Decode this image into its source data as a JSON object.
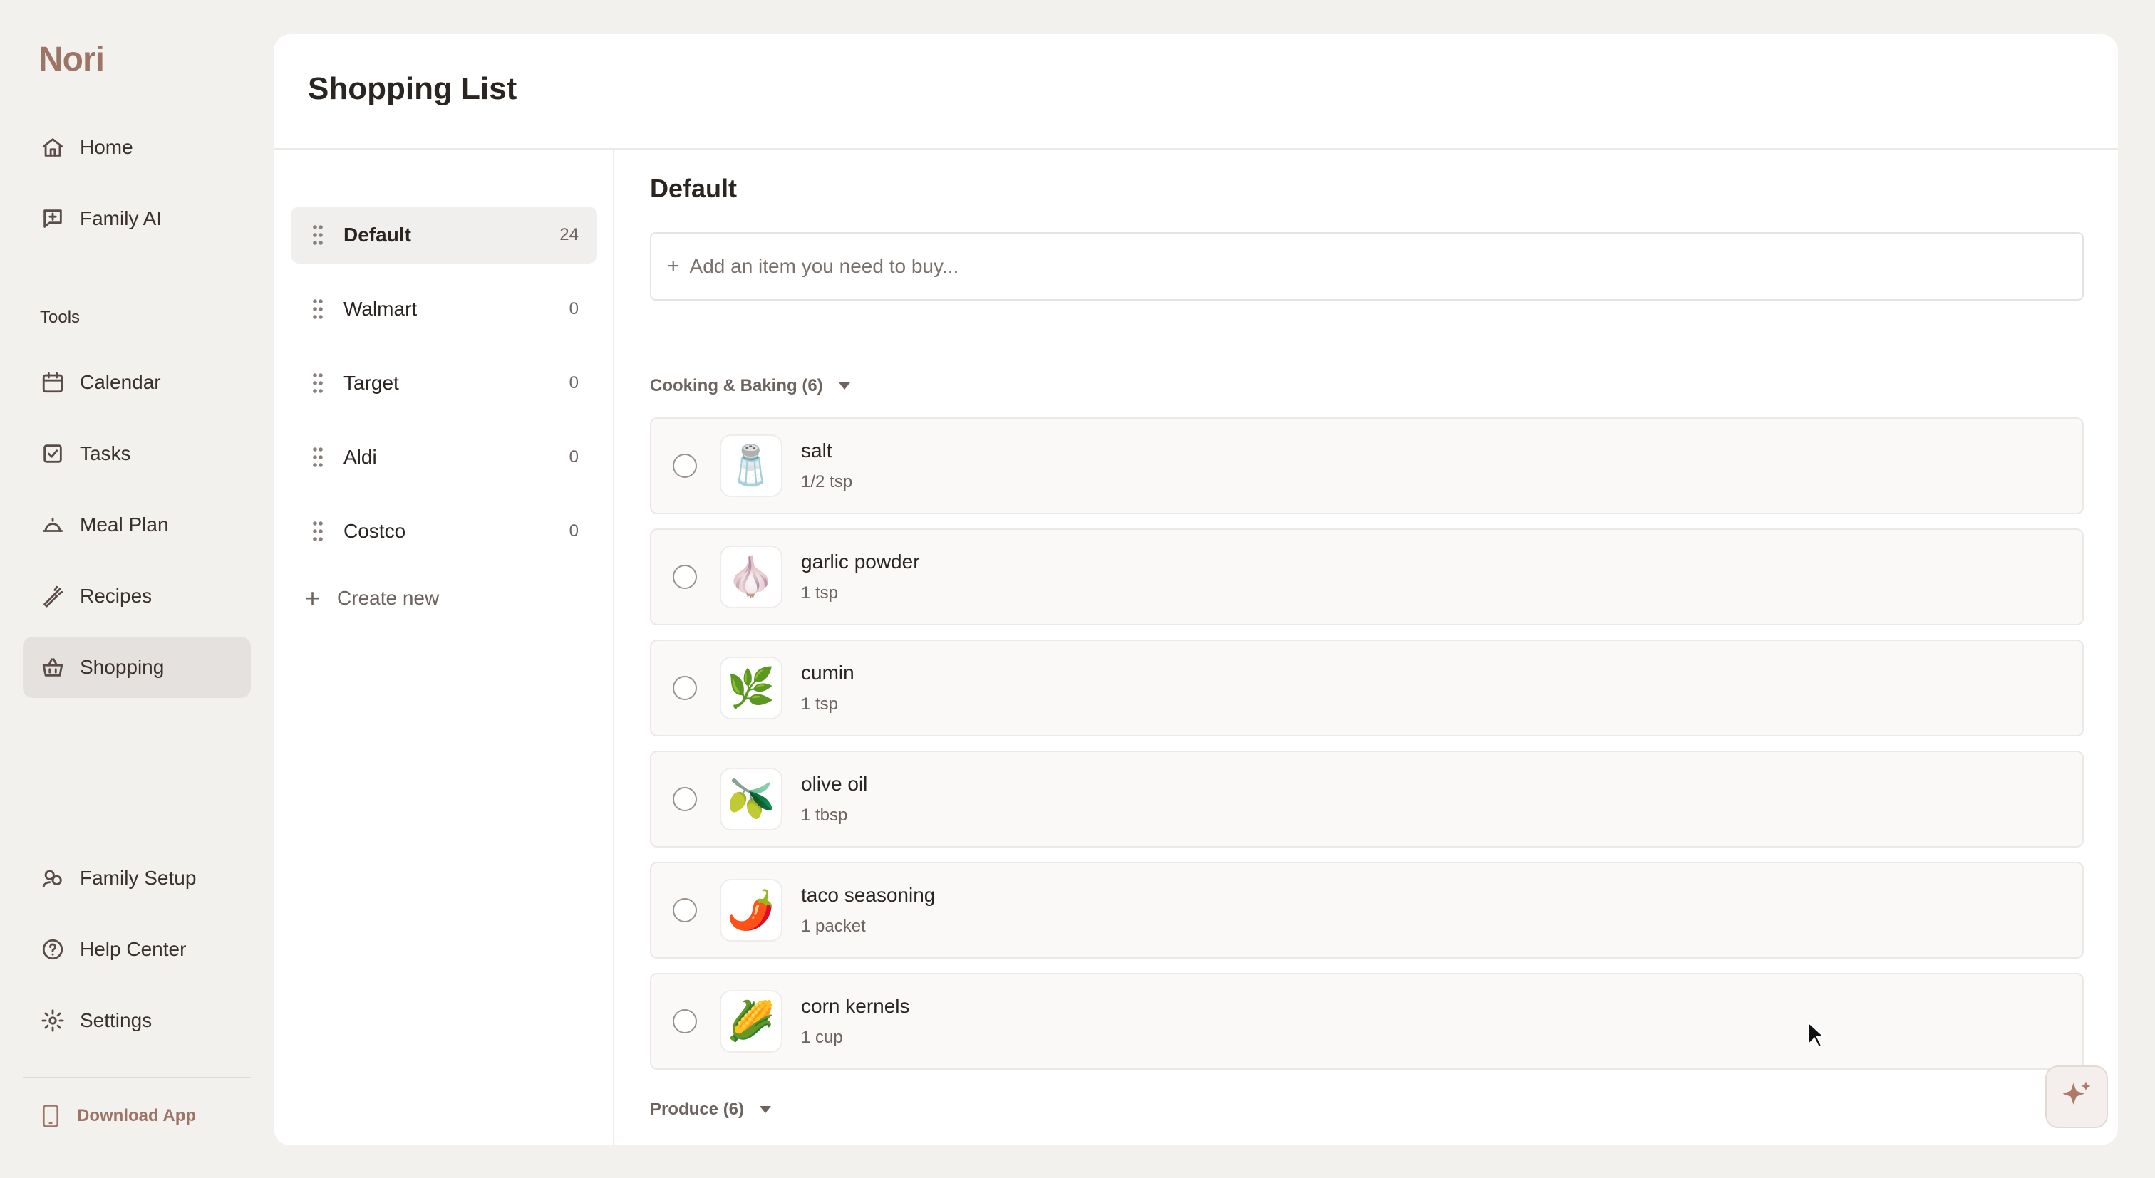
{
  "app": {
    "logo": "Nori"
  },
  "sidebar": {
    "primary": [
      {
        "label": "Home",
        "icon": "home-icon"
      },
      {
        "label": "Family AI",
        "icon": "chat-plus-icon"
      }
    ],
    "tools_label": "Tools",
    "tools": [
      {
        "label": "Calendar",
        "icon": "calendar-icon"
      },
      {
        "label": "Tasks",
        "icon": "checkbox-icon"
      },
      {
        "label": "Meal Plan",
        "icon": "cloche-icon"
      },
      {
        "label": "Recipes",
        "icon": "carrot-icon"
      },
      {
        "label": "Shopping",
        "icon": "basket-icon",
        "active": true
      }
    ],
    "bottom": [
      {
        "label": "Family Setup",
        "icon": "family-icon"
      },
      {
        "label": "Help Center",
        "icon": "help-icon"
      },
      {
        "label": "Settings",
        "icon": "gear-icon"
      }
    ],
    "download": "Download App"
  },
  "page": {
    "title": "Shopping List"
  },
  "lists": {
    "items": [
      {
        "name": "Default",
        "count": "24",
        "active": true
      },
      {
        "name": "Walmart",
        "count": "0"
      },
      {
        "name": "Target",
        "count": "0"
      },
      {
        "name": "Aldi",
        "count": "0"
      },
      {
        "name": "Costco",
        "count": "0"
      }
    ],
    "create_new": "Create new"
  },
  "detail": {
    "title": "Default",
    "add_placeholder": "Add an item you need to buy...",
    "categories": [
      {
        "label": "Cooking & Baking (6)",
        "items": [
          {
            "name": "salt",
            "qty": "1/2 tsp",
            "emoji": "🧂"
          },
          {
            "name": "garlic powder",
            "qty": "1 tsp",
            "emoji": "🧄"
          },
          {
            "name": "cumin",
            "qty": "1 tsp",
            "emoji": "🌿"
          },
          {
            "name": "olive oil",
            "qty": "1 tbsp",
            "emoji": "🫒"
          },
          {
            "name": "taco seasoning",
            "qty": "1 packet",
            "emoji": "🌶️"
          },
          {
            "name": "corn kernels",
            "qty": "1 cup",
            "emoji": "🌽"
          }
        ]
      },
      {
        "label": "Produce (6)",
        "items": []
      }
    ]
  },
  "colors": {
    "brand": "#9c7566",
    "active_bg": "#e4e1de",
    "ai_accent": "#b07868"
  }
}
